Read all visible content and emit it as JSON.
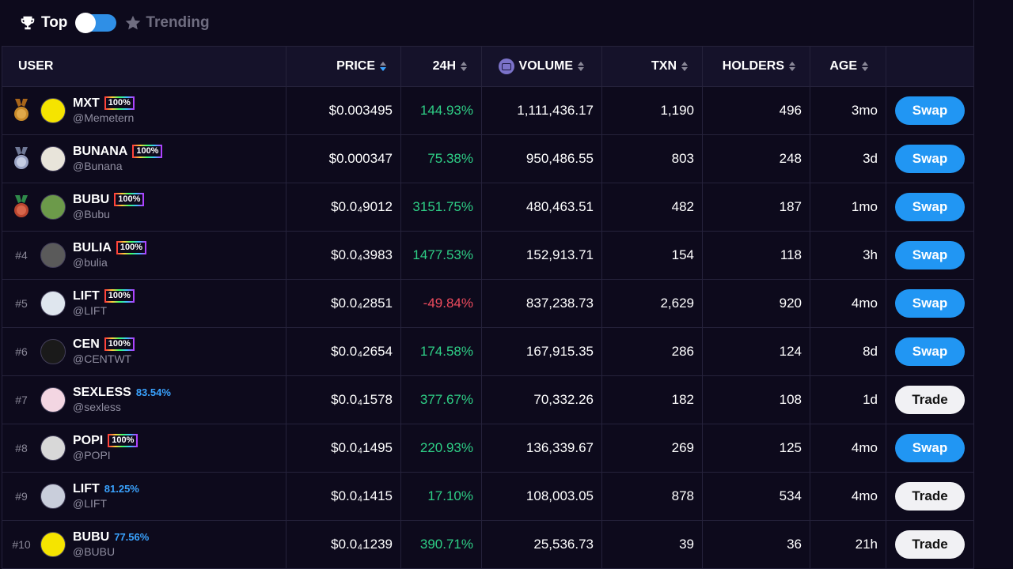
{
  "topbar": {
    "top_label": "Top",
    "trending_label": "Trending",
    "toggle_on": true
  },
  "colors": {
    "accent": "#2196f3",
    "positive": "#2ecf86",
    "negative": "#ee4b5d",
    "bg": "#0d0a1c"
  },
  "columns": {
    "user": "USER",
    "price": "PRICE",
    "h24": "24H",
    "volume": "VOLUME",
    "txn": "TXN",
    "holders": "HOLDERS",
    "age": "AGE"
  },
  "rows": [
    {
      "rank": "",
      "medal": "gold",
      "name": "MXT",
      "badge": "100%",
      "badge_style": "rainbow",
      "handle": "@Memetern",
      "price": "$0.003495",
      "change": "144.93%",
      "dir": "pos",
      "volume": "1,111,436.17",
      "txn": "1,190",
      "holders": "496",
      "age": "3mo",
      "action": "Swap",
      "avatar_color": "#f5e400"
    },
    {
      "rank": "",
      "medal": "silver",
      "name": "BUNANA",
      "badge": "100%",
      "badge_style": "rainbow",
      "handle": "@Bunana",
      "price": "$0.000347",
      "change": "75.38%",
      "dir": "pos",
      "volume": "950,486.55",
      "txn": "803",
      "holders": "248",
      "age": "3d",
      "action": "Swap",
      "avatar_color": "#e8e4da"
    },
    {
      "rank": "",
      "medal": "bronze",
      "name": "BUBU",
      "badge": "100%",
      "badge_style": "rainbow",
      "handle": "@Bubu",
      "price": "$0.0₄9012",
      "change": "3151.75%",
      "dir": "pos",
      "volume": "480,463.51",
      "txn": "482",
      "holders": "187",
      "age": "1mo",
      "action": "Swap",
      "avatar_color": "#6c9a4a"
    },
    {
      "rank": "#4",
      "medal": "",
      "name": "BULIA",
      "badge": "100%",
      "badge_style": "rainbow",
      "handle": "@bulia",
      "price": "$0.0₄3983",
      "change": "1477.53%",
      "dir": "pos",
      "volume": "152,913.71",
      "txn": "154",
      "holders": "118",
      "age": "3h",
      "action": "Swap",
      "avatar_color": "#5a5a5a"
    },
    {
      "rank": "#5",
      "medal": "",
      "name": "LIFT",
      "badge": "100%",
      "badge_style": "rainbow",
      "handle": "@LIFT",
      "price": "$0.0₄2851",
      "change": "-49.84%",
      "dir": "neg",
      "volume": "837,238.73",
      "txn": "2,629",
      "holders": "920",
      "age": "4mo",
      "action": "Swap",
      "avatar_color": "#dfe6ee"
    },
    {
      "rank": "#6",
      "medal": "",
      "name": "CEN",
      "badge": "100%",
      "badge_style": "rainbow",
      "handle": "@CENTWT",
      "price": "$0.0₄2654",
      "change": "174.58%",
      "dir": "pos",
      "volume": "167,915.35",
      "txn": "286",
      "holders": "124",
      "age": "8d",
      "action": "Swap",
      "avatar_color": "#1a1a1a"
    },
    {
      "rank": "#7",
      "medal": "",
      "name": "SEXLESS",
      "badge": "83.54%",
      "badge_style": "plain",
      "handle": "@sexless",
      "price": "$0.0₄1578",
      "change": "377.67%",
      "dir": "pos",
      "volume": "70,332.26",
      "txn": "182",
      "holders": "108",
      "age": "1d",
      "action": "Trade",
      "avatar_color": "#f3d6e2"
    },
    {
      "rank": "#8",
      "medal": "",
      "name": "POPI",
      "badge": "100%",
      "badge_style": "rainbow",
      "handle": "@POPI",
      "price": "$0.0₄1495",
      "change": "220.93%",
      "dir": "pos",
      "volume": "136,339.67",
      "txn": "269",
      "holders": "125",
      "age": "4mo",
      "action": "Swap",
      "avatar_color": "#d8d8d8"
    },
    {
      "rank": "#9",
      "medal": "",
      "name": "LIFT",
      "badge": "81.25%",
      "badge_style": "plain",
      "handle": "@LIFT",
      "price": "$0.0₄1415",
      "change": "17.10%",
      "dir": "pos",
      "volume": "108,003.05",
      "txn": "878",
      "holders": "534",
      "age": "4mo",
      "action": "Trade",
      "avatar_color": "#c9cedb"
    },
    {
      "rank": "#10",
      "medal": "",
      "name": "BUBU",
      "badge": "77.56%",
      "badge_style": "plain",
      "handle": "@BUBU",
      "price": "$0.0₄1239",
      "change": "390.71%",
      "dir": "pos",
      "volume": "25,536.73",
      "txn": "39",
      "holders": "36",
      "age": "21h",
      "action": "Trade",
      "avatar_color": "#f5e400"
    }
  ]
}
